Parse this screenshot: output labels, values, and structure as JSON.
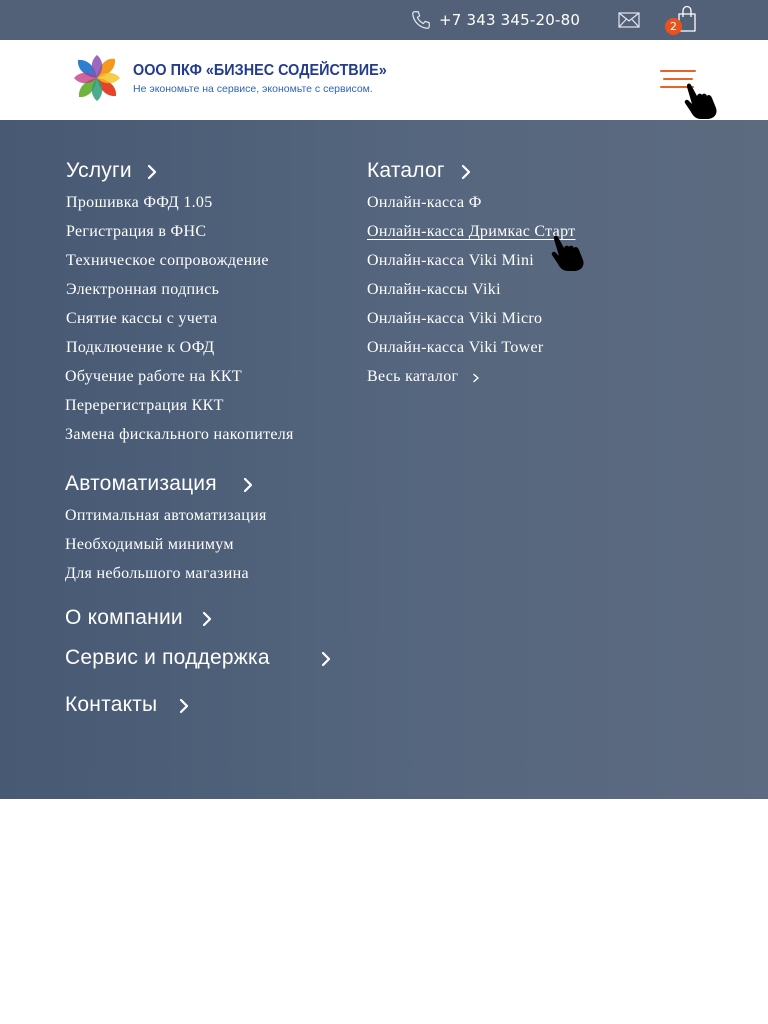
{
  "topbar": {
    "phone": "+7 343 345-20-80",
    "cart_count": "2",
    "icons": [
      "phone-icon",
      "mail-icon",
      "shopping-bag-icon"
    ],
    "badge_color": "#e8531c"
  },
  "header": {
    "logo_title": "ООО ПКФ «БИЗНЕС СОДЕЙСТВИЕ»",
    "logo_slogan": "Не экономьте на сервисе, экономьте с сервисом.",
    "menu_icon": "hamburger-icon",
    "accent_color": "#e8622a"
  },
  "menu": {
    "services": {
      "title": "Услуги",
      "items": [
        "Прошивка ФФД 1.05",
        "Регистрация в ФНС",
        "Техническое сопровождение",
        "Электронная подпись",
        "Снятие кассы с учета",
        "Подключение к ОФД",
        "Обучение работе на ККТ",
        "Перерегистрация ККТ",
        "Замена фискального накопителя"
      ]
    },
    "catalog": {
      "title": "Каталог",
      "items": [
        "Онлайн-касса Ф",
        "Онлайн-касса Дримкас Старт",
        "Онлайн-касса Viki Mini",
        "Онлайн-кассы Viki",
        "Онлайн-касса Viki Micro",
        "Онлайн-касса Viki Tower",
        "Весь каталог"
      ]
    },
    "automation": {
      "title": "Автоматизация",
      "items": [
        "Оптимальная автоматизация",
        "Необходимый минимум",
        "Для небольшого магазина"
      ]
    },
    "about": "О компании",
    "support": "Сервис и поддержка",
    "contacts": "Контакты",
    "background_color": "#4e5f77"
  }
}
